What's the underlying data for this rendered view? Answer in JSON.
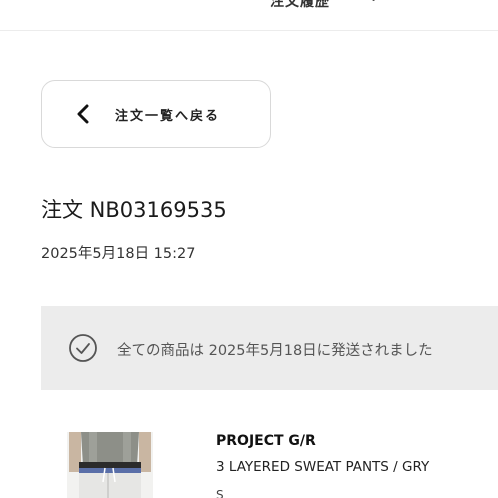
{
  "header": {
    "label": "注文履歴",
    "chevron": "v"
  },
  "back_button": {
    "label": "注文一覧へ戻る",
    "icon": "chevron-left-icon"
  },
  "order": {
    "title": "注文 NB03169535",
    "date": "2025年5月18日 15:27"
  },
  "status_banner": {
    "icon": "check-circle-icon",
    "text": "全ての商品は 2025年5月18日に発送されました"
  },
  "product": {
    "brand": "PROJECT G/R",
    "name": "3 LAYERED SWEAT PANTS / GRY",
    "extra": "S"
  },
  "colors": {
    "banner_bg": "#ececec",
    "border": "#d9d9d9",
    "text": "#1a1a1a",
    "muted_text": "#555555"
  }
}
